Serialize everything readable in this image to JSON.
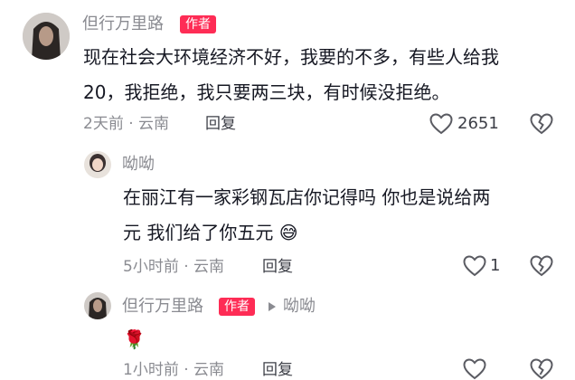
{
  "comments": [
    {
      "author": "但行万里路",
      "author_tag": "作者",
      "text_line1": "现在社会大环境经济不好，我要的不多，有些人给我",
      "text_line2": "20，我拒绝，我只要两三块，有时候没拒绝。",
      "time_location": "2天前 · 云南",
      "reply_label": "回复",
      "likes": "2651"
    },
    {
      "author": "呦呦",
      "text_line1": "在丽江有一家彩钢瓦店你记得吗 你也是说给两",
      "text_line2": "元 我们给了你五元",
      "emoji": "😅",
      "time_location": "5小时前 · 云南",
      "reply_label": "回复",
      "likes": "1"
    },
    {
      "author": "但行万里路",
      "author_tag": "作者",
      "reply_to": "呦呦",
      "emoji": "🌹",
      "time_location": "1小时前 · 云南",
      "reply_label": "回复"
    }
  ],
  "icons": {
    "like": "heart-outline-icon",
    "dislike": "broken-heart-icon",
    "reply_arrow": "triangle-right-icon"
  },
  "colors": {
    "author_tag": "#fe2c55",
    "secondary_text": "#8a8b91"
  }
}
